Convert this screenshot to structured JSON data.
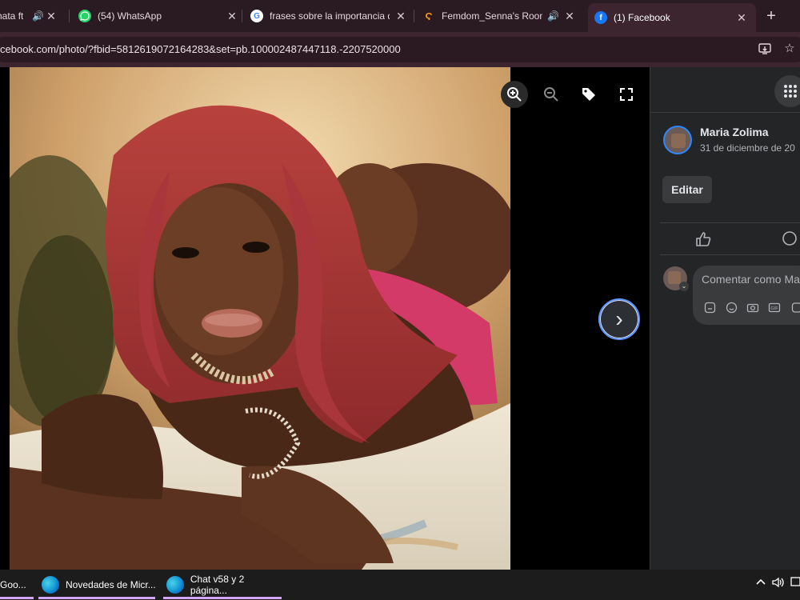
{
  "tabs": [
    {
      "title": "hata ft",
      "favicon": "speaker-tab",
      "audio": true
    },
    {
      "title": "(54) WhatsApp",
      "favicon": "whatsapp-icon",
      "audio": false
    },
    {
      "title": "frases sobre la importancia d",
      "favicon": "google-icon",
      "audio": false
    },
    {
      "title": "Femdom_Senna's Room",
      "favicon": "chaturbate-icon",
      "audio": true
    },
    {
      "title": "(1) Facebook",
      "favicon": "facebook-icon",
      "audio": false,
      "active": true
    }
  ],
  "newtab_label": "+",
  "url": "cebook.com/photo/?fbid=5812619072164283&set=pb.100002487447118.-2207520000",
  "toolbar_icons": [
    "install-app-icon",
    "star-icon"
  ],
  "viewer": {
    "controls": [
      "zoom-in-icon",
      "zoom-out-icon",
      "tag-icon",
      "fullscreen-icon"
    ],
    "next_label": "›"
  },
  "post": {
    "author": "Maria Zolima",
    "date": "31 de diciembre de 20",
    "edit_label": "Editar",
    "comment_placeholder": "Comentar como Ma",
    "comment_tools": [
      "sticker-icon",
      "emoji-icon",
      "camera-icon",
      "gif-icon",
      "avatar-sticker-icon"
    ]
  },
  "taskbar": {
    "items": [
      {
        "label": "Goo..."
      },
      {
        "label": "Novedades de Micr..."
      },
      {
        "label": "Chat v58 y 2 página..."
      }
    ],
    "tray": [
      "chevron-up-icon",
      "volume-icon"
    ]
  },
  "colors": {
    "tab_bg": "#2a1a22",
    "active_tab": "#3d2530",
    "panel_bg": "#242526",
    "accent_blue": "#5e94ff",
    "taskbar_underline": "#d4a7ff"
  }
}
